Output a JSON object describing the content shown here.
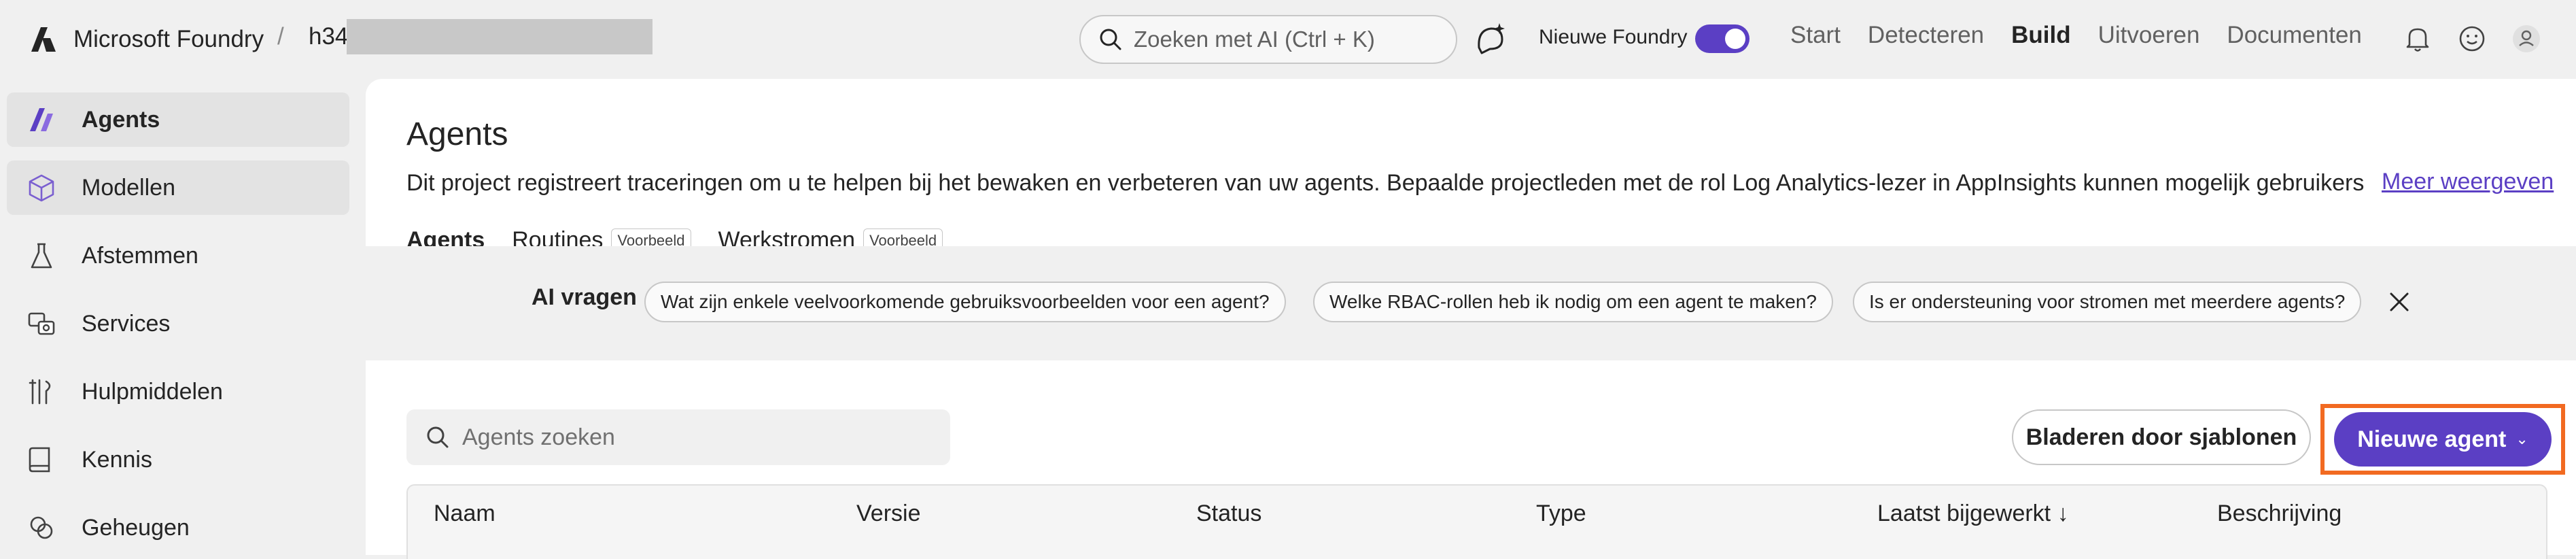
{
  "header": {
    "brand_name": "Microsoft Foundry",
    "breadcrumb_separator": "/",
    "project_name": "h34l",
    "search_placeholder": "Zoeken met AI (Ctrl + K)",
    "new_foundry_label": "Nieuwe Foundry",
    "new_foundry_enabled": true,
    "nav": [
      {
        "label": "Start",
        "active": false
      },
      {
        "label": "Detecteren",
        "active": false
      },
      {
        "label": "Build",
        "active": true
      },
      {
        "label": "Uitvoeren",
        "active": false
      },
      {
        "label": "Documenten",
        "active": false
      }
    ],
    "icons": [
      "copilot-icon",
      "bell-icon",
      "smiley-icon",
      "user-icon"
    ]
  },
  "sidebar": {
    "items": [
      {
        "label": "Agents",
        "icon": "agents-icon",
        "active": true
      },
      {
        "label": "Modellen",
        "icon": "cube-icon",
        "active": false
      },
      {
        "label": "Afstemmen",
        "icon": "flask-icon",
        "active": false
      },
      {
        "label": "Services",
        "icon": "services-icon",
        "active": false
      },
      {
        "label": "Hulpmiddelen",
        "icon": "tools-icon",
        "active": false
      },
      {
        "label": "Kennis",
        "icon": "book-icon",
        "active": false
      },
      {
        "label": "Geheugen",
        "icon": "memory-icon",
        "active": false
      }
    ]
  },
  "main": {
    "title": "Agents",
    "description": "Dit project registreert traceringen om u te helpen bij het bewaken en verbeteren van uw agents. Bepaalde projectleden met de rol Log Analytics-lezer in AppInsights kunnen mogelijk gebruikers...",
    "more_link": "Meer weergeven",
    "tabs": [
      {
        "label": "Agents",
        "badge": "",
        "active": true
      },
      {
        "label": "Routines",
        "badge": "Voorbeeld",
        "active": false
      },
      {
        "label": "Werkstromen",
        "badge": "Voorbeeld",
        "active": false
      }
    ],
    "ai_questions": {
      "title": "AI vragen",
      "chips": [
        "Wat zijn enkele veelvoorkomende gebruiksvoorbeelden voor een agent?",
        "Welke RBAC-rollen heb ik nodig om een agent te maken?",
        "Is er ondersteuning voor stromen met meerdere agents?"
      ]
    },
    "search_placeholder": "Agents zoeken",
    "browse_templates_label": "Bladeren door sjablonen",
    "new_agent_label": "Nieuwe agent",
    "table": {
      "columns": [
        "Naam",
        "Versie",
        "Status",
        "Type",
        "Laatst bijgewerkt ↓",
        "Beschrijving"
      ]
    }
  },
  "colors": {
    "accent": "#5b3fc4",
    "highlight": "#f26a21",
    "background": "#f0f0f0",
    "panel": "#ffffff"
  }
}
